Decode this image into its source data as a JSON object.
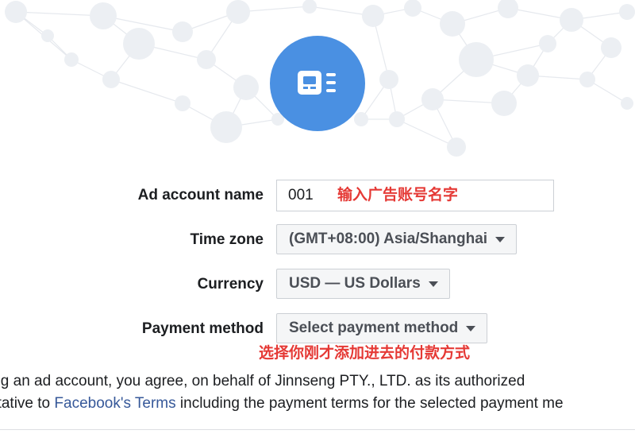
{
  "form": {
    "ad_account_name": {
      "label": "Ad account name",
      "value": "001",
      "annotation": "输入广告账号名字"
    },
    "time_zone": {
      "label": "Time zone",
      "selected": "(GMT+08:00) Asia/Shanghai"
    },
    "currency": {
      "label": "Currency",
      "selected": "USD — US Dollars"
    },
    "payment_method": {
      "label": "Payment method",
      "selected": "Select payment method",
      "annotation": "选择你刚才添加进去的付款方式"
    }
  },
  "terms": {
    "line1": "ing an ad account, you agree, on behalf of Jinnseng PTY., LTD. as its authorized",
    "line2_prefix": "ntative to ",
    "link_text": "Facebook's Terms",
    "line2_suffix": " including the payment terms for the selected payment me"
  },
  "icons": {
    "hero": "ad-account-icon",
    "dropdown": "chevron-down-icon"
  },
  "colors": {
    "hero_circle": "#4a90e2",
    "annotation": "#e53935",
    "link": "#365899"
  }
}
